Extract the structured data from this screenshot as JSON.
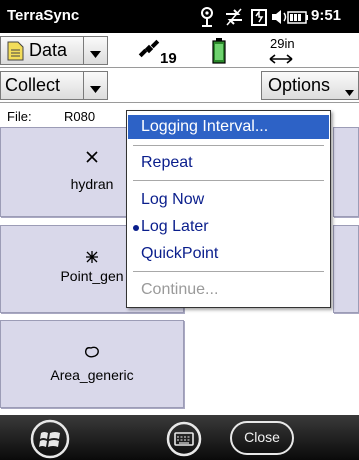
{
  "status_bar": {
    "app_title": "TerraSync",
    "clock": "9:51",
    "icons": [
      "signal-icon",
      "connectivity-icon",
      "battery-charging-icon",
      "volume-icon",
      "battery-icon"
    ]
  },
  "toolbar": {
    "section_label": "Data",
    "satellite_count": "19",
    "distance_value": "29in",
    "icons": [
      "document-icon",
      "dropdown-arrow-icon",
      "satellite-icon",
      "battery-icon",
      "double-arrow-icon"
    ]
  },
  "toolbar2": {
    "mode_label": "Collect",
    "options_label": "Options"
  },
  "file": {
    "label": "File:",
    "name": "R080"
  },
  "tiles": [
    {
      "label": "hydran",
      "icon": "point-x-icon"
    },
    {
      "label": "Point_gen",
      "icon": "point-star-icon"
    },
    {
      "label": "Area_generic",
      "icon": "area-icon"
    }
  ],
  "menu": {
    "items": [
      {
        "label": "Logging Interval...",
        "state": "highlighted"
      },
      {
        "label": "Repeat",
        "state": "normal"
      },
      {
        "label": "Log Now",
        "state": "normal"
      },
      {
        "label": "Log Later",
        "state": "checked"
      },
      {
        "label": "QuickPoint",
        "state": "normal"
      },
      {
        "label": "Continue...",
        "state": "disabled"
      }
    ]
  },
  "bottom_bar": {
    "close_label": "Close",
    "icons": [
      "windows-start-icon",
      "keyboard-icon"
    ]
  },
  "colors": {
    "menu_highlight": "#2d62c6",
    "menu_text": "#0a1e8c",
    "tile_fill": "#d9d8ea",
    "status_bar": "#000000"
  }
}
